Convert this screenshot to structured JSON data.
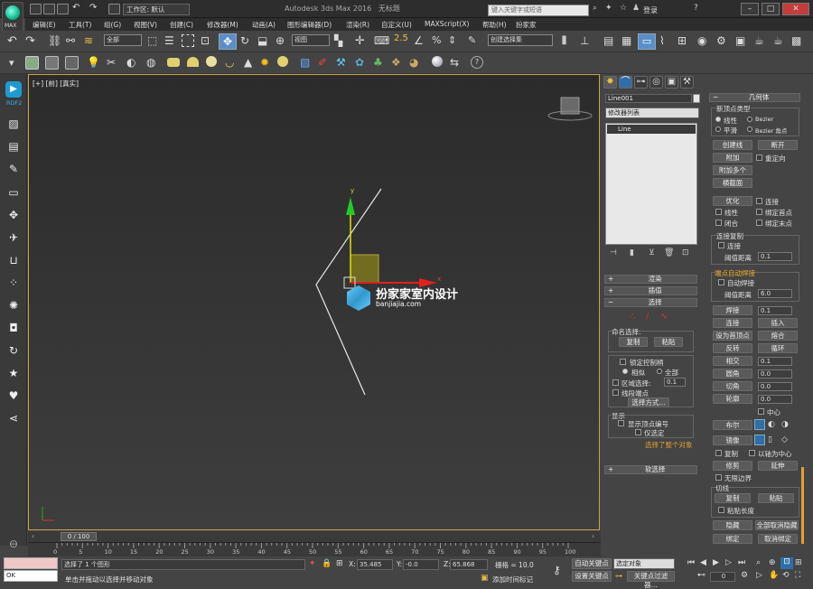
{
  "titlebar": {
    "workspace": "工作区: 默认",
    "app_title": "Autodesk 3ds Max 2016",
    "file_name": "无标题",
    "search_placeholder": "键入关键字或短语",
    "login": "登录",
    "logo_text": "MAX"
  },
  "menubar": [
    "编辑(E)",
    "工具(T)",
    "组(G)",
    "视图(V)",
    "创建(C)",
    "修改器(M)",
    "动画(A)",
    "图形编辑器(D)",
    "渲染(R)",
    "自定义(U)",
    "MAXScript(X)",
    "帮助(H)",
    "扮家家"
  ],
  "toolbar": {
    "selection_filter": "全部",
    "ref_coord": "视图",
    "named_sets": "创建选择集"
  },
  "leftrail": {
    "rdf_label": "RDF2"
  },
  "viewport": {
    "label": "[+] [前] [真实]",
    "axis_y": "y",
    "axis_x": "x",
    "watermark_cn": "扮家家室内设计",
    "watermark_url": "banjiajia.com"
  },
  "command_panel": {
    "object_name": "Line001",
    "modifier_list": "修改器列表",
    "stack_item": "Line",
    "geometry": {
      "header": "几何体",
      "new_vertex_type": "新顶点类型",
      "linear": "线性",
      "bezier": "Bezier",
      "smooth": "平滑",
      "bezier_corner": "Bezier 角点",
      "create_line": "创建线",
      "break": "断开",
      "attach": "附加",
      "reorient": "重定向",
      "attach_mult": "附加多个",
      "cross_section": "横截面",
      "refine": "优化",
      "connect": "连接",
      "linear2": "线性",
      "bind_first": "绑定首点",
      "closed": "闭合",
      "bind_last": "绑定末点",
      "connect_copy": "连接复制",
      "connect2": "连接",
      "threshold": "阈值距离",
      "threshold_val": "0.1",
      "auto_weld": "端点自动焊接",
      "auto_weld_chk": "自动焊接",
      "threshold2": "阈值距离",
      "threshold2_val": "6.0",
      "weld": "焊接",
      "weld_val": "0.1",
      "connect3": "连接",
      "insert": "插入",
      "make_first": "设为首顶点",
      "fuse": "熔合",
      "reverse": "反转",
      "cycle": "循环",
      "cross_insert": "相交",
      "cross_val": "0.1",
      "fillet": "圆角",
      "fillet_val": "0.0",
      "chamfer": "切角",
      "chamfer_val": "0.0",
      "outline": "轮廓",
      "outline_val": "0.0",
      "center": "中心",
      "boolean": "布尔",
      "mirror": "镜像",
      "copy": "复制",
      "about_pivot": "以轴为中心",
      "trim": "修剪",
      "extend": "延伸",
      "infinite_bounds": "无限边界",
      "tangent": "切线",
      "copy2": "复制",
      "paste": "粘贴",
      "paste_length": "粘贴长度",
      "hide": "隐藏",
      "unhide_all": "全部取消隐藏",
      "bind": "绑定",
      "unbind": "取消绑定"
    },
    "rollouts": {
      "render": "渲染",
      "interp": "插值",
      "selection": "选择",
      "named_sel": "命名选择:",
      "copy": "复制",
      "paste": "粘贴",
      "lock_handles": "锁定控制柄",
      "alike": "相似",
      "all": "全部",
      "area_sel": "区域选择:",
      "area_val": "0.1",
      "segment_end": "线段端点",
      "select_by": "选择方式...",
      "display": "显示",
      "show_vertex_num": "显示顶点编号",
      "only_selected": "仅选定",
      "selected_status": "选择了整个对象",
      "soft_sel": "软选择"
    }
  },
  "timeline": {
    "frame": "0 / 100",
    "ticks": [
      "0",
      "5",
      "10",
      "15",
      "20",
      "25",
      "30",
      "35",
      "40",
      "45",
      "50",
      "55",
      "60",
      "65",
      "70",
      "75",
      "80",
      "85",
      "90",
      "95",
      "100"
    ]
  },
  "status": {
    "selected": "选择了 1 个图形",
    "prompt": "单击并拖动以选择并移动对象",
    "x_label": "X:",
    "x_val": "35.485",
    "y_label": "Y:",
    "y_val": "-0.0",
    "z_label": "Z:",
    "z_val": "65.868",
    "grid": "栅格 = 10.0",
    "auto_key": "自动关键点",
    "set_key": "设置关键点",
    "key_filter_sel": "选定对象",
    "key_filters": "关键点过滤器...",
    "add_time_tag": "添加时间标记",
    "ok": "OK",
    "frame_val": "0"
  }
}
